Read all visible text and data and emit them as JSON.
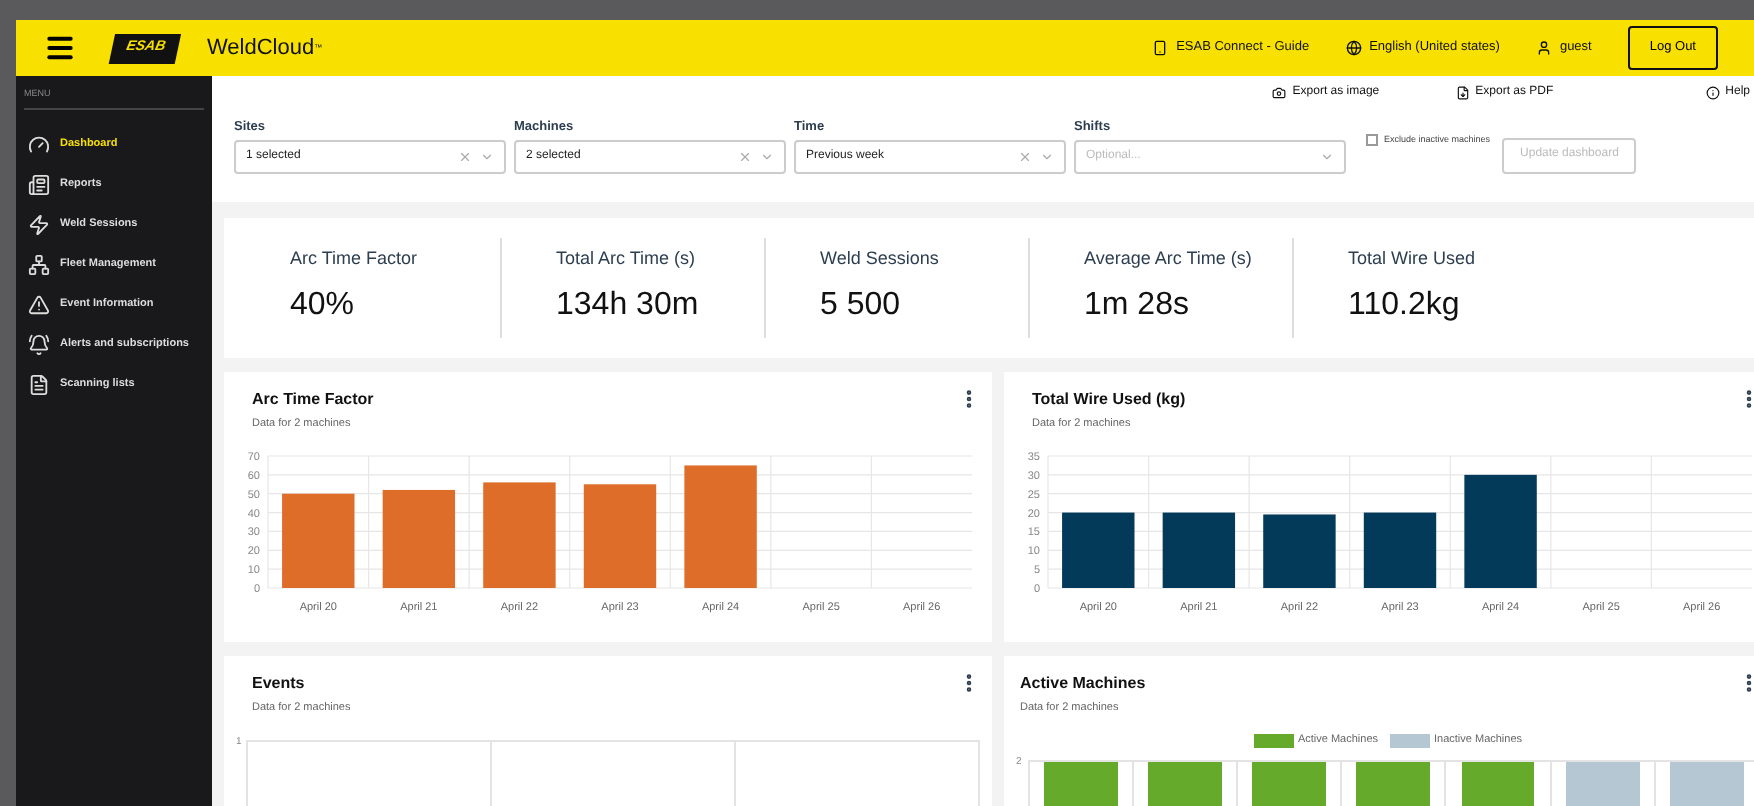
{
  "header": {
    "logo": "ESAB",
    "app_name": "WeldCloud",
    "trademark": "™",
    "links": [
      {
        "kind": "phone",
        "label": "ESAB Connect - Guide"
      },
      {
        "kind": "globe",
        "label": "English (United states)"
      },
      {
        "kind": "user",
        "label": "guest"
      }
    ],
    "logout": "Log Out"
  },
  "sidebar": {
    "heading": "MENU",
    "items": [
      {
        "kind": "gauge",
        "label": "Dashboard",
        "selected": true
      },
      {
        "kind": "reports",
        "label": "Reports",
        "selected": false
      },
      {
        "kind": "bolt",
        "label": "Weld Sessions",
        "selected": false
      },
      {
        "kind": "tree",
        "label": "Fleet Management",
        "selected": false
      },
      {
        "kind": "warning",
        "label": "Event Information",
        "selected": false
      },
      {
        "kind": "bell",
        "label": "Alerts and subscriptions",
        "selected": false
      },
      {
        "kind": "list",
        "label": "Scanning lists",
        "selected": false
      }
    ]
  },
  "toolbar": [
    {
      "kind": "camera",
      "label": "Export as image"
    },
    {
      "kind": "pdf",
      "label": "Export as PDF"
    },
    {
      "kind": "info",
      "label": "Help"
    }
  ],
  "filters": [
    {
      "label": "Sites",
      "value": "1 selected",
      "clearable": true
    },
    {
      "label": "Machines",
      "value": "2 selected",
      "clearable": true
    },
    {
      "label": "Time",
      "value": "Previous week",
      "clearable": true
    },
    {
      "label": "Shifts",
      "placeholder": "Optional...",
      "clearable": false
    }
  ],
  "exclude_inactive": {
    "label": "Exclude inactive machines",
    "checked": false
  },
  "update_button": {
    "label": "Update dashboard",
    "disabled": true
  },
  "kpis": [
    {
      "label": "Arc Time Factor",
      "value": "40%"
    },
    {
      "label": "Total Arc Time (s)",
      "value": "134h 30m"
    },
    {
      "label": "Weld Sessions",
      "value": "5 500"
    },
    {
      "label": "Average Arc Time (s)",
      "value": "1m 28s"
    },
    {
      "label": "Total Wire Used",
      "value": "110.2kg"
    }
  ],
  "charts": [
    {
      "title": "Arc Time Factor",
      "subtitle": "Data for 2 machines",
      "chart_data": {
        "type": "bar",
        "categories": [
          "April 20",
          "April 21",
          "April 22",
          "April 23",
          "April 24",
          "April 25",
          "April 26"
        ],
        "series": [
          {
            "color": "#dd6d28",
            "values": [
              50,
              52,
              56,
              55,
              65,
              null,
              null
            ]
          }
        ],
        "grid": true,
        "ylim": [
          0,
          70
        ],
        "yticks": [
          0,
          10,
          20,
          30,
          40,
          50,
          60,
          70
        ]
      }
    },
    {
      "title": "Total Wire Used (kg)",
      "subtitle": "Data for 2 machines",
      "chart_data": {
        "type": "bar",
        "categories": [
          "April 20",
          "April 21",
          "April 22",
          "April 23",
          "April 24",
          "April 25",
          "April 26"
        ],
        "series": [
          {
            "color": "#033a5a",
            "values": [
              20,
              20,
              19.5,
              20,
              30,
              null,
              null
            ]
          }
        ],
        "grid": true,
        "ylim": [
          0,
          35
        ],
        "yticks": [
          0,
          5,
          10,
          15,
          20,
          25,
          30,
          35
        ]
      }
    }
  ],
  "events": {
    "title": "Events",
    "subtitle": "Data for 2 machines",
    "tick": "1"
  },
  "active_machines": {
    "title": "Active Machines",
    "subtitle": "Data for 2 machines",
    "tick": "2",
    "legend": [
      {
        "kind": "active",
        "label": "Active Machines",
        "color": "#66aa2c"
      },
      {
        "kind": "inactive",
        "label": "Inactive Machines",
        "color": "#b5c7d2"
      }
    ],
    "bars": [
      {
        "kind": "active"
      },
      {
        "kind": "active"
      },
      {
        "kind": "active"
      },
      {
        "kind": "active"
      },
      {
        "kind": "active"
      },
      {
        "kind": "inactive"
      },
      {
        "kind": "inactive"
      }
    ]
  }
}
